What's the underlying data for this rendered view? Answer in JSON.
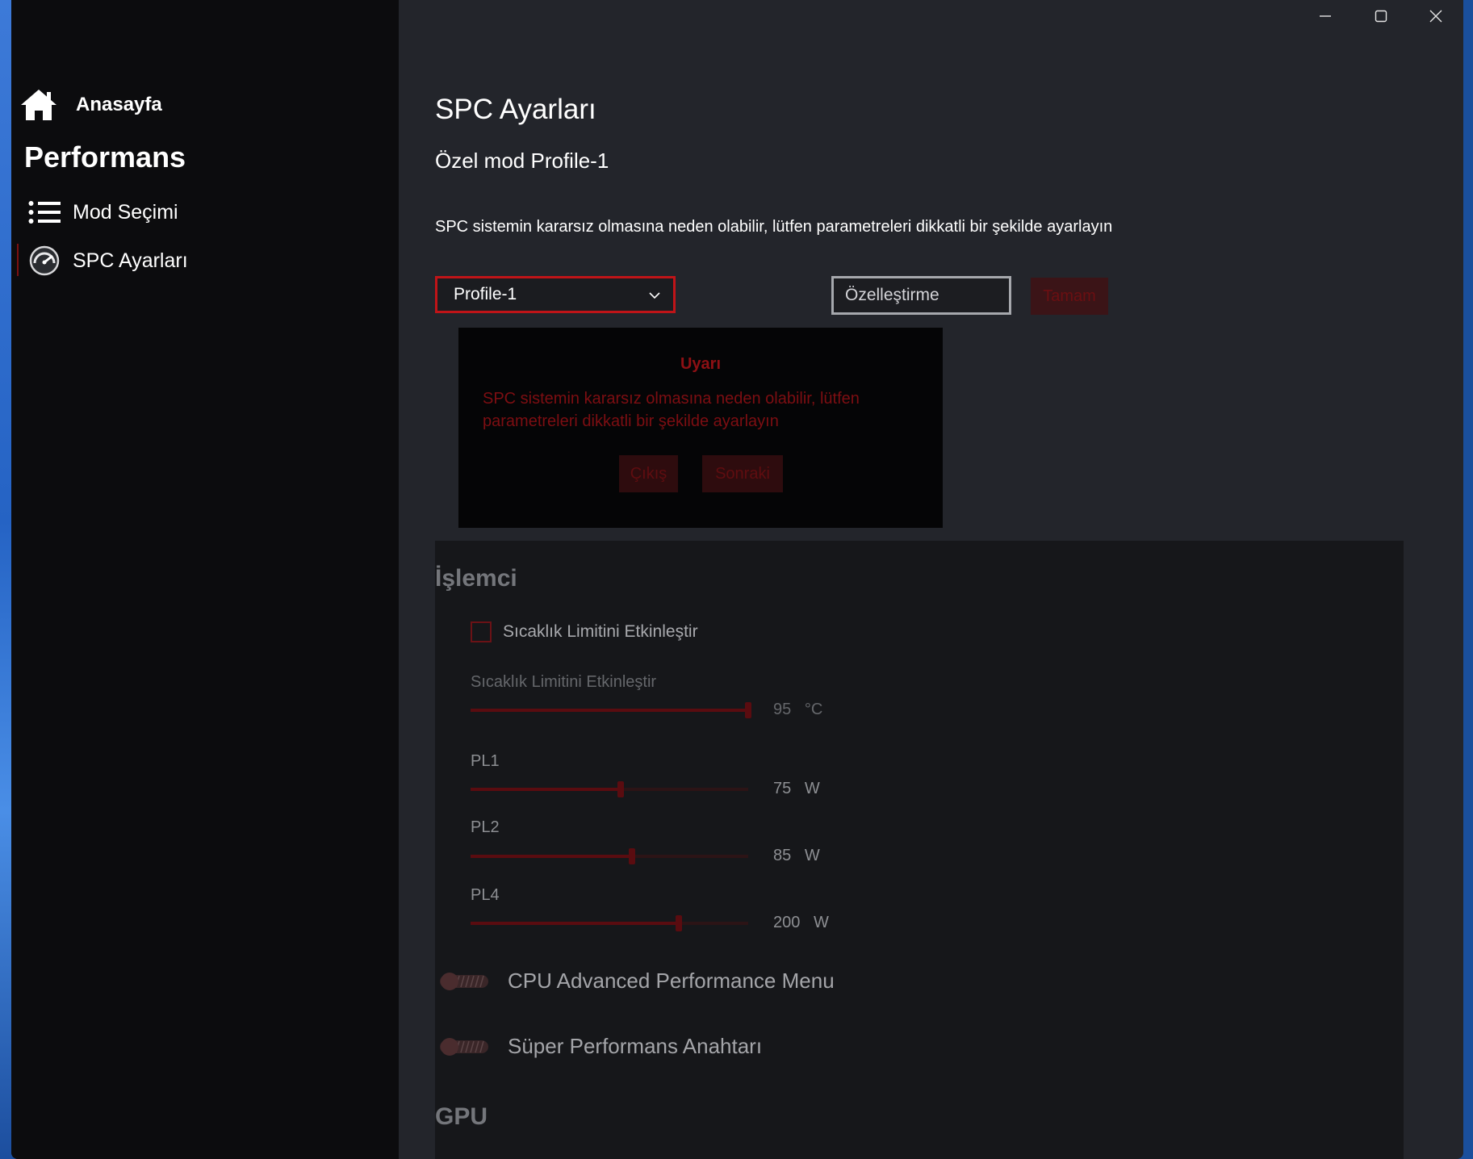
{
  "sidebar": {
    "home_label": "Anasayfa",
    "section_title": "Performans",
    "items": [
      {
        "label": "Mod Seçimi",
        "icon": "list-icon"
      },
      {
        "label": "SPC Ayarları",
        "icon": "gauge-icon",
        "active": true
      }
    ]
  },
  "window_controls": {
    "minimize": "minimize-icon",
    "maximize": "maximize-icon",
    "close": "close-icon"
  },
  "main": {
    "title": "SPC Ayarları",
    "subtitle": "Özel mod Profile-1",
    "description": "SPC sistemin kararsız olmasına neden olabilir, lütfen parametreleri dikkatli bir şekilde ayarlayın",
    "profile_select": {
      "value": "Profile-1"
    },
    "custom_input": {
      "value": "Özelleştirme"
    },
    "ok_label": "Tamam"
  },
  "dialog": {
    "title": "Uyarı",
    "message": "SPC sistemin kararsız olmasına neden olabilir, lütfen parametreleri dikkatli bir şekilde ayarlayın",
    "exit_label": "Çıkış",
    "next_label": "Sonraki"
  },
  "cpu": {
    "title": "İşlemci",
    "temp_checkbox_label": "Sıcaklık Limitini Etkinleştir",
    "temp_checked": false,
    "sliders": [
      {
        "label": "Sıcaklık Limitini Etkinleştir",
        "value": "95",
        "unit": "°C",
        "fraction": 1.0
      },
      {
        "label": "PL1",
        "value": "75",
        "unit": "W",
        "fraction": 0.54
      },
      {
        "label": "PL2",
        "value": "85",
        "unit": "W",
        "fraction": 0.58
      },
      {
        "label": "PL4",
        "value": "200",
        "unit": "W",
        "fraction": 0.75
      }
    ],
    "toggles": [
      {
        "label": "CPU Advanced Performance Menu",
        "on": false
      },
      {
        "label": "Süper Performans Anahtarı",
        "on": false
      }
    ]
  },
  "gpu": {
    "title": "GPU"
  },
  "colors": {
    "accent": "#c01418",
    "sidebar_bg": "#0c0c0e",
    "content_bg": "#23252b",
    "panel_bg": "#16171a"
  }
}
